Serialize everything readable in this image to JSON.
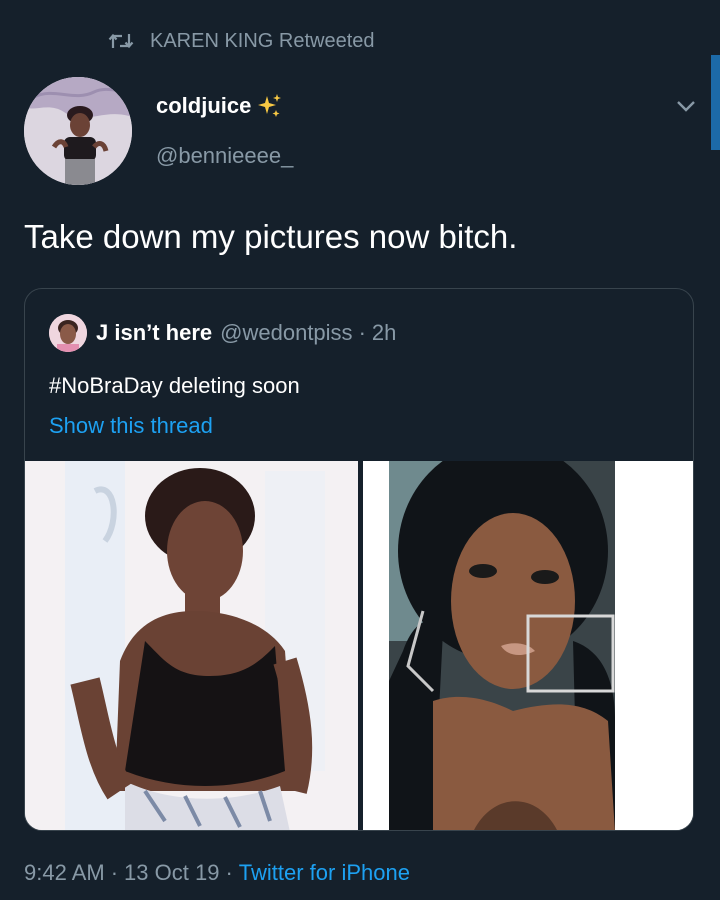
{
  "retweet": {
    "label": "KAREN KING Retweeted",
    "icon": "retweet-icon"
  },
  "tweet": {
    "display_name": "coldjuice",
    "name_emoji_icon": "sparkles-icon",
    "handle": "@bennieeee_",
    "text": "Take down my pictures now bitch.",
    "menu_icon": "chevron-down-icon"
  },
  "quoted": {
    "display_name": "J isn’t here",
    "handle": "@wedontpiss",
    "separator": "·",
    "time": "2h",
    "text": "#NoBraDay deleting soon",
    "show_thread": "Show this thread"
  },
  "footer": {
    "time": "9:42 AM",
    "sep1": "·",
    "date": "13 Oct 19",
    "sep2": "·",
    "source": "Twitter for iPhone"
  },
  "colors": {
    "background": "#15202b",
    "secondary_text": "#8899a6",
    "link": "#1da1f2",
    "border": "#38444d"
  }
}
